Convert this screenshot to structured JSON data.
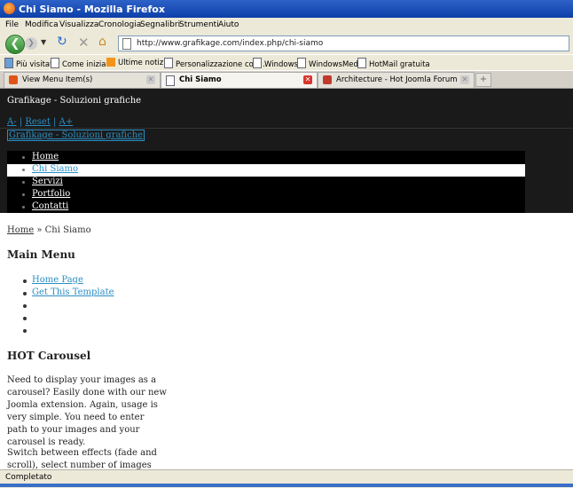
{
  "window": {
    "title": "Chi Siamo - Mozilla Firefox"
  },
  "menubar": [
    "File",
    "Modifica",
    "Visualizza",
    "Cronologia",
    "Segnalibri",
    "Strumenti",
    "Aiuto"
  ],
  "address": {
    "url": "http://www.grafikage.com/index.php/chi-siamo"
  },
  "bookmarks": [
    "Più visitati",
    "Come iniziare",
    "Ultime notizie",
    "Personalizzazione coll...",
    "Windows",
    "WindowsMedia",
    "HotMail gratuita"
  ],
  "tabs": [
    {
      "label": "View Menu Item(s)"
    },
    {
      "label": "Chi Siamo"
    },
    {
      "label": "Architecture - Hot Joomla Forum"
    }
  ],
  "site": {
    "name": "Grafikage - Soluzioni grafiche",
    "font_controls": {
      "decrease": "A-",
      "sep1": " | ",
      "reset": "Reset",
      "sep2": " | ",
      "increase": "A+"
    },
    "logo_link": "Grafikage - Soluzioni grafiche",
    "nav": [
      "Home",
      "Chi Siamo",
      "Servizi",
      "Portfolio",
      "Contatti"
    ],
    "breadcrumb": {
      "home": "Home",
      "sep": " » ",
      "current": "Chi Siamo"
    },
    "main_menu": {
      "title": "Main Menu",
      "items": [
        "Home Page",
        "Get This Template"
      ]
    },
    "carousel": {
      "title": "HOT Carousel",
      "para1": "Need to display your images as a carousel? Easily done with our new Joomla extension. Again, usage is very simple. You need to enter path to your images and your carousel is ready.",
      "para2": "Switch between effects (fade and scroll), select number of images and image sizes"
    }
  },
  "status": {
    "text": "Completato"
  },
  "colors": {
    "link": "#2a8fc4",
    "header_bg": "#1a1a1a",
    "titlebar": "#2d62c8"
  }
}
